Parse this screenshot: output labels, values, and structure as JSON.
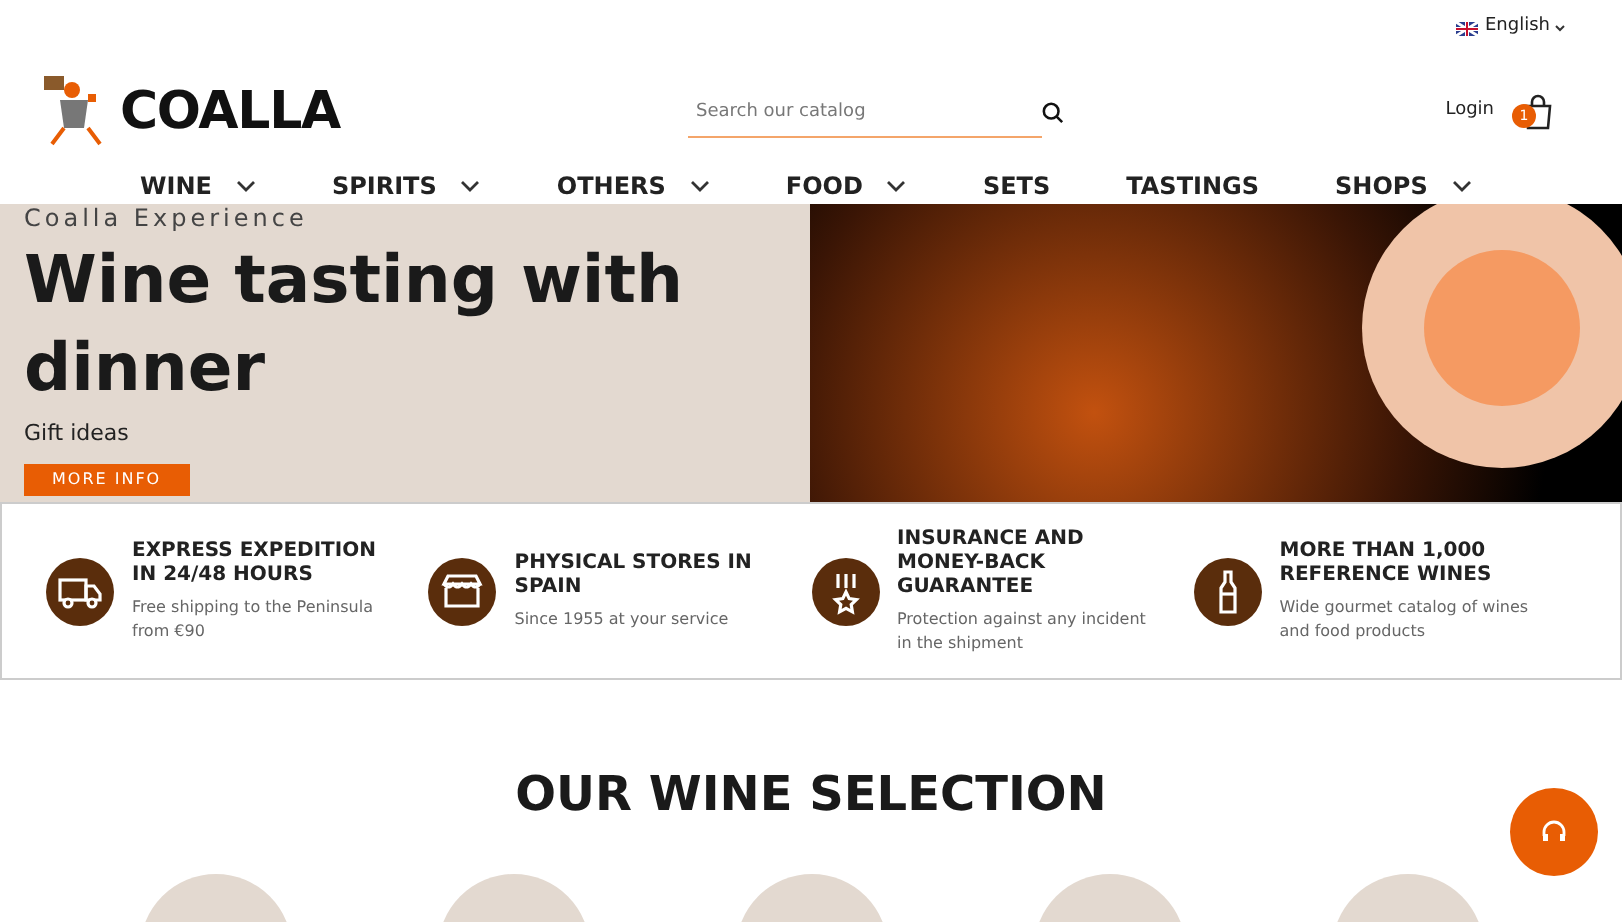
{
  "language": {
    "label": "English"
  },
  "header": {
    "logo": "COALLA",
    "search": {
      "placeholder": "Search our catalog"
    },
    "login": "Login",
    "cart_count": "1"
  },
  "nav": [
    {
      "label": "WINE",
      "has_menu": true
    },
    {
      "label": "SPIRITS",
      "has_menu": true
    },
    {
      "label": "OTHERS",
      "has_menu": true
    },
    {
      "label": "FOOD",
      "has_menu": true
    },
    {
      "label": "SETS",
      "has_menu": false
    },
    {
      "label": "TASTINGS",
      "has_menu": false
    },
    {
      "label": "SHOPS",
      "has_menu": true
    }
  ],
  "hero": {
    "eyebrow": "Coalla Experience",
    "title": "Wine tasting with dinner",
    "subtitle": "Gift ideas",
    "button": "MORE INFO"
  },
  "features": [
    {
      "kind": "truck",
      "title": "EXPRESS EXPEDITION IN 24/48 HOURS",
      "text": "Free shipping to the Peninsula from €90"
    },
    {
      "kind": "store",
      "title": "PHYSICAL STORES IN SPAIN",
      "text": "Since 1955 at your service"
    },
    {
      "kind": "medal",
      "title": "INSURANCE AND MONEY-BACK GUARANTEE",
      "text": "Protection against any incident in the shipment"
    },
    {
      "kind": "bottle",
      "title": "MORE THAN 1,000 REFERENCE WINES",
      "text": "Wide gourmet catalog of wines and food products"
    }
  ],
  "selection": {
    "title": "OUR WINE SELECTION"
  }
}
